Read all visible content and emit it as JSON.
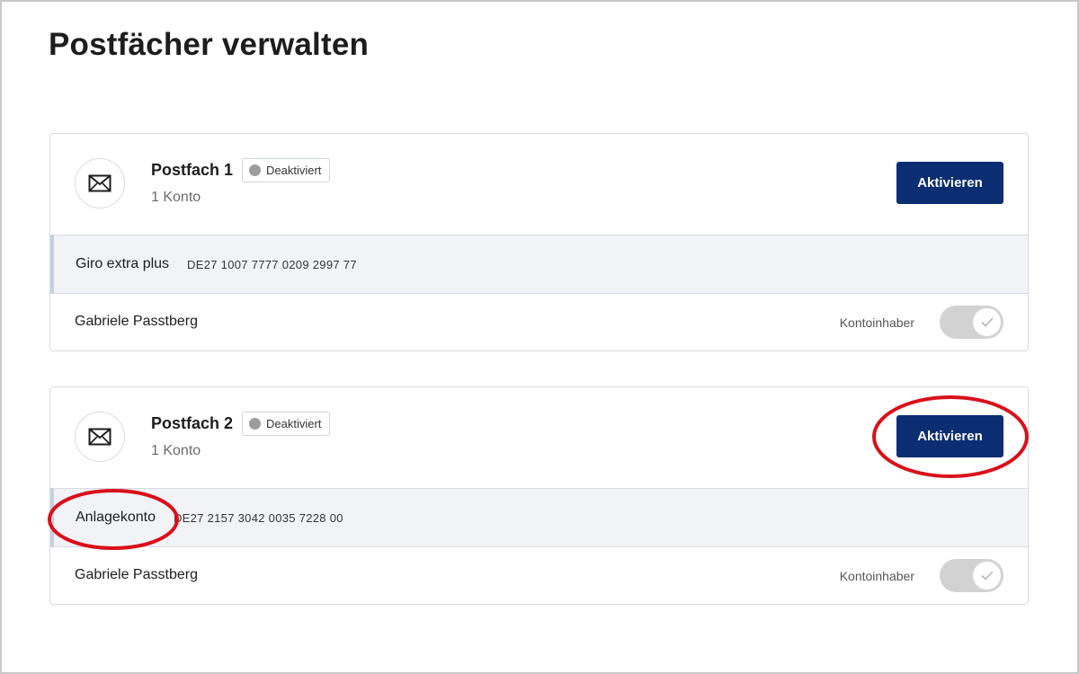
{
  "page": {
    "title": "Postfächer verwalten"
  },
  "colors": {
    "primary_button": "#0b2d72",
    "annotation_circle": "#d9101a",
    "badge_dot": "#9c9c9c"
  },
  "mailboxes": [
    {
      "icon": "envelope-icon",
      "name": "Postfach 1",
      "status": "Deaktiviert",
      "count": "1 Konto",
      "action_label": "Aktivieren",
      "account": {
        "name": "Giro extra plus",
        "iban": "DE27 1007 7777 0209 2997 77"
      },
      "owner": {
        "name": "Gabriele Passtberg",
        "role": "Kontoinhaber"
      }
    },
    {
      "icon": "envelope-icon",
      "name": "Postfach 2",
      "status": "Deaktiviert",
      "count": "1 Konto",
      "action_label": "Aktivieren",
      "account": {
        "name": "Anlagekonto",
        "iban": "DE27 2157 3042 0035 7228 00"
      },
      "owner": {
        "name": "Gabriele Passtberg",
        "role": "Kontoinhaber"
      }
    }
  ]
}
